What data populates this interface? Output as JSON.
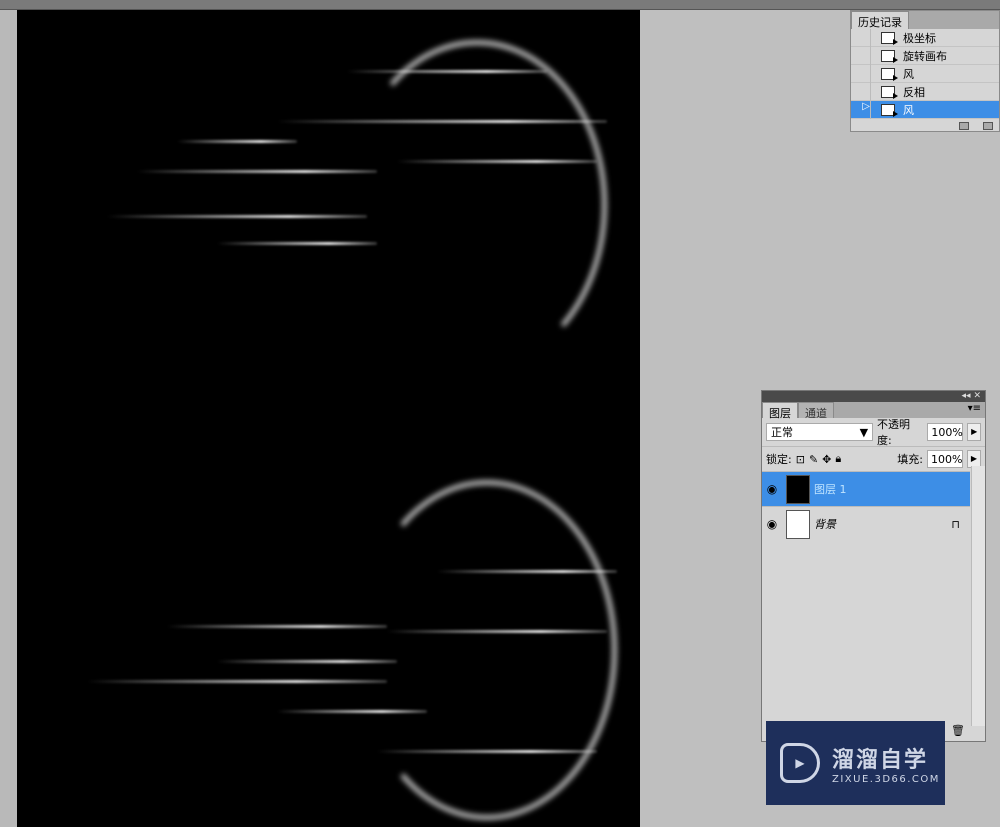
{
  "history_panel": {
    "tab_label": "历史记录",
    "items": [
      {
        "label": "极坐标",
        "selected": false
      },
      {
        "label": "旋转画布",
        "selected": false
      },
      {
        "label": "风",
        "selected": false
      },
      {
        "label": "反相",
        "selected": false
      },
      {
        "label": "风",
        "selected": true
      }
    ]
  },
  "layers_panel": {
    "tabs": [
      "图层",
      "通道"
    ],
    "blend_mode": "正常",
    "opacity_label": "不透明度:",
    "opacity_value": "100%",
    "lock_label": "锁定:",
    "fill_label": "填充:",
    "fill_value": "100%",
    "layers": [
      {
        "name": "图层 1",
        "selected": true
      },
      {
        "name": "背景",
        "selected": false,
        "locked": true
      }
    ]
  },
  "watermark": {
    "title": "溜溜自学",
    "url": "ZIXUE.3D66.COM"
  },
  "colors": {
    "selection": "#3d8ee6",
    "watermark_bg": "#1e2f5b"
  }
}
